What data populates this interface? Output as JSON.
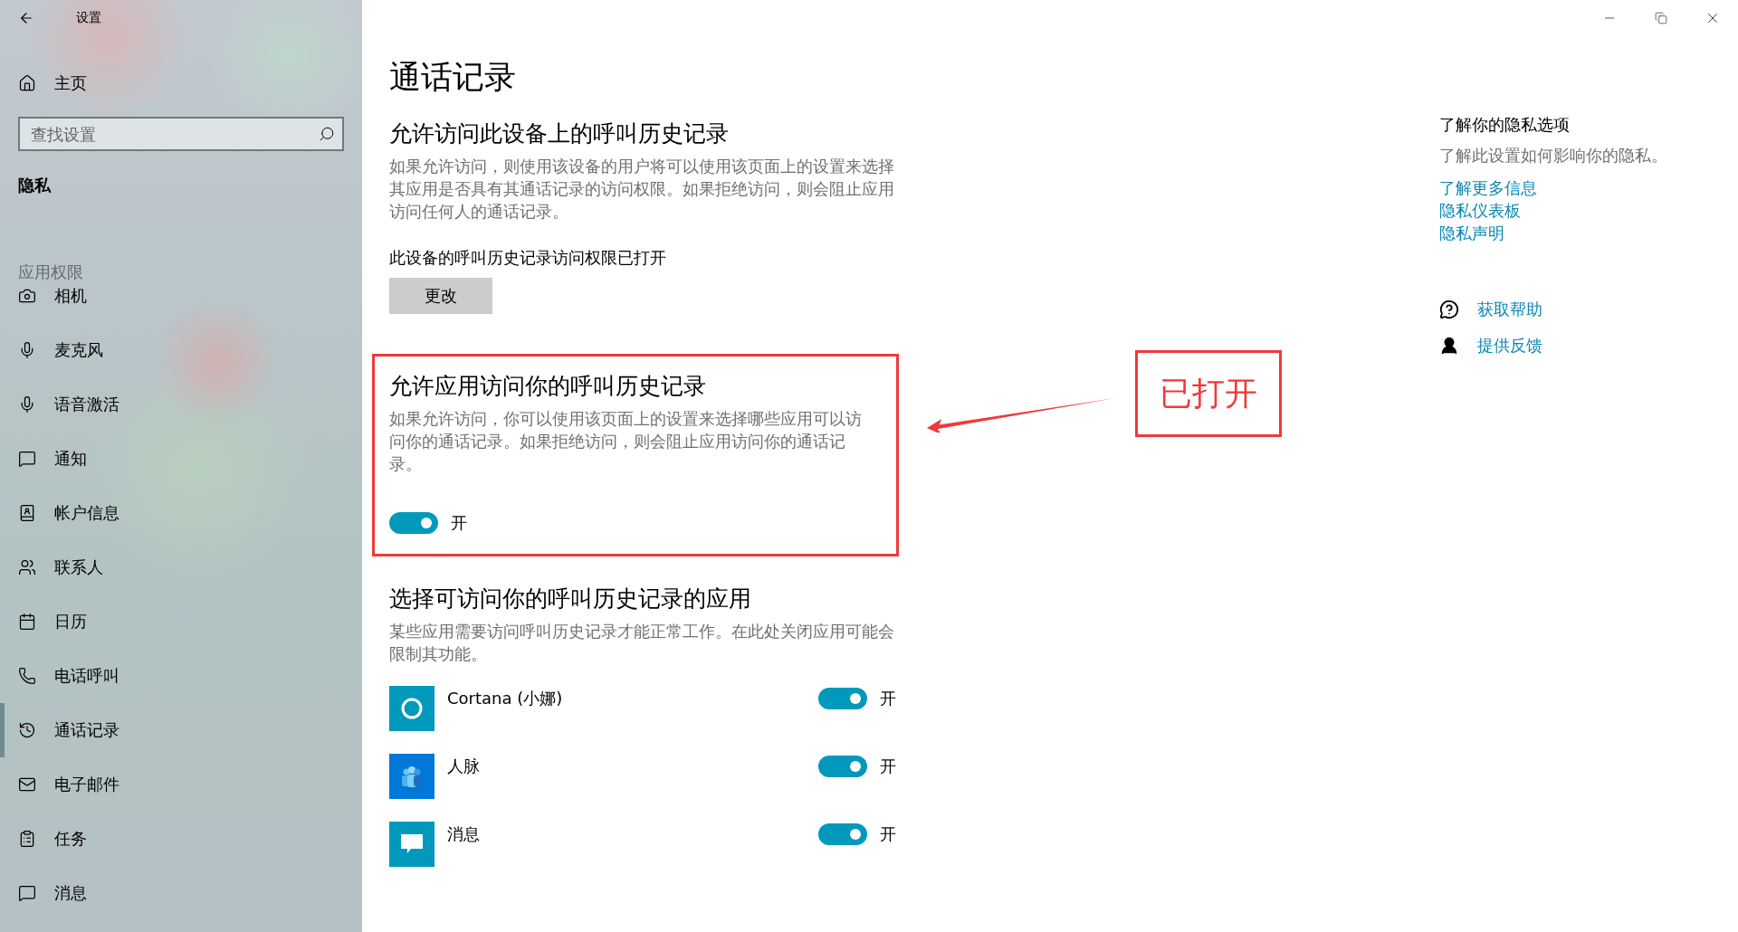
{
  "window": {
    "title": "设置"
  },
  "sidebar": {
    "home": "主页",
    "search": {
      "placeholder": "查找设置"
    },
    "category": "隐私",
    "group_label": "应用权限",
    "items": [
      {
        "label": "相机",
        "selected": false
      },
      {
        "label": "麦克风",
        "selected": false
      },
      {
        "label": "语音激活",
        "selected": false
      },
      {
        "label": "通知",
        "selected": false
      },
      {
        "label": "帐户信息",
        "selected": false
      },
      {
        "label": "联系人",
        "selected": false
      },
      {
        "label": "日历",
        "selected": false
      },
      {
        "label": "电话呼叫",
        "selected": false
      },
      {
        "label": "通话记录",
        "selected": true
      },
      {
        "label": "电子邮件",
        "selected": false
      },
      {
        "label": "任务",
        "selected": false
      },
      {
        "label": "消息",
        "selected": false
      }
    ]
  },
  "page": {
    "title": "通话记录",
    "device_section": {
      "heading": "允许访问此设备上的呼叫历史记录",
      "description": "如果允许访问，则使用该设备的用户将可以使用该页面上的设置来选择其应用是否具有其通话记录的访问权限。如果拒绝访问，则会阻止应用访问任何人的通话记录。",
      "status": "此设备的呼叫历史记录访问权限已打开",
      "button": "更改"
    },
    "app_section": {
      "heading": "允许应用访问你的呼叫历史记录",
      "description": "如果允许访问，你可以使用该页面上的设置来选择哪些应用可以访问你的通话记录。如果拒绝访问，则会阻止应用访问你的通话记录。",
      "toggle": {
        "on": true,
        "label": "开"
      }
    },
    "apps_section": {
      "heading": "选择可访问你的呼叫历史记录的应用",
      "description": "某些应用需要访问呼叫历史记录才能正常工作。在此处关闭应用可能会限制其功能。",
      "apps": [
        {
          "name": "Cortana (小娜)",
          "kind": "cortana",
          "on": true,
          "label": "开"
        },
        {
          "name": "人脉",
          "kind": "people",
          "on": true,
          "label": "开"
        },
        {
          "name": "消息",
          "kind": "messaging",
          "on": true,
          "label": "开"
        }
      ]
    }
  },
  "right_panel": {
    "heading": "了解你的隐私选项",
    "text": "了解此设置如何影响你的隐私。",
    "links": [
      "了解更多信息",
      "隐私仪表板",
      "隐私声明"
    ],
    "help_links": [
      "获取帮助",
      "提供反馈"
    ]
  },
  "annotation": {
    "label": "已打开"
  }
}
